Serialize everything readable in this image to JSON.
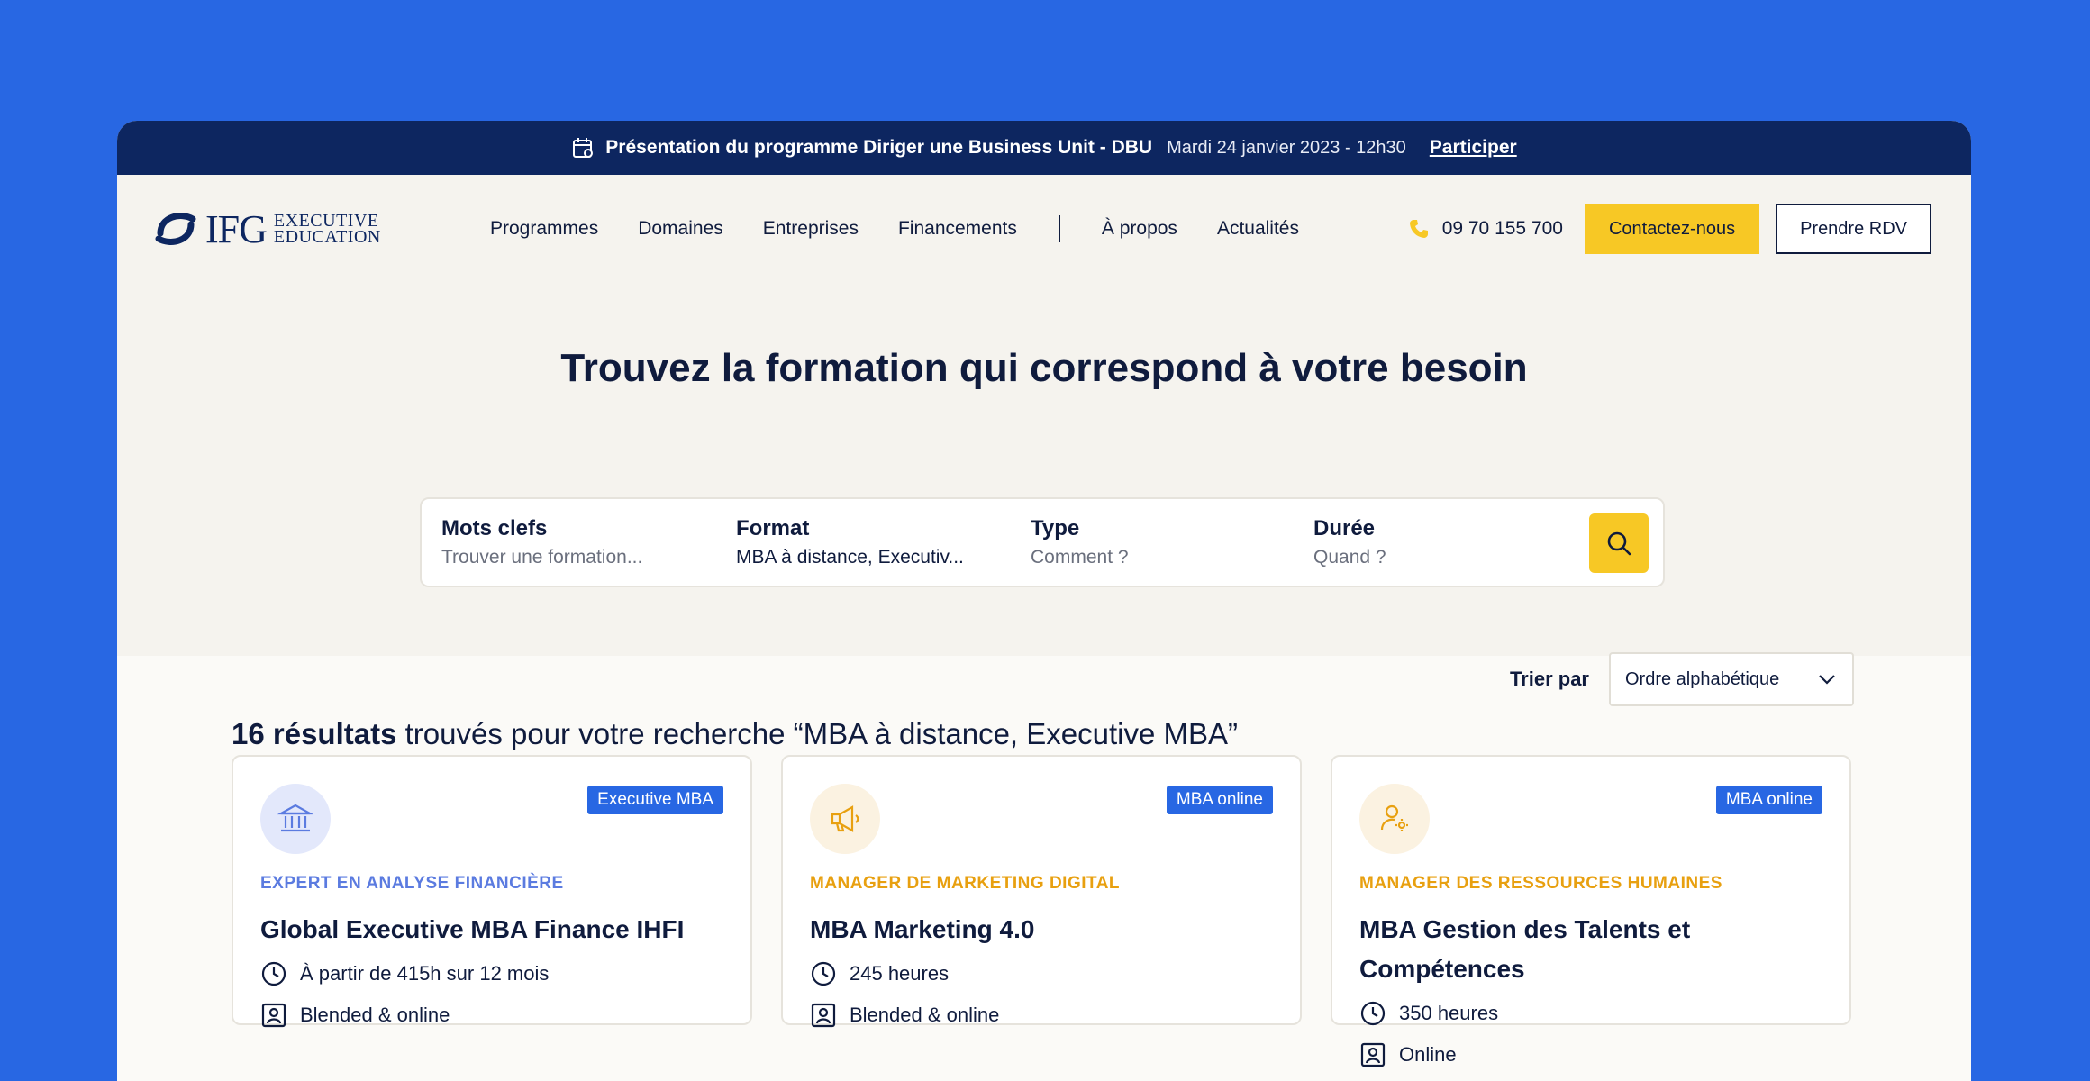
{
  "announcement": {
    "title": "Présentation du programme Diriger une Business Unit - DBU",
    "date": "Mardi 24 janvier 2023 - 12h30",
    "cta": "Participer"
  },
  "logo": {
    "brand": "IFG",
    "line1": "EXECUTIVE",
    "line2": "EDUCATION"
  },
  "nav": {
    "items": [
      "Programmes",
      "Domaines",
      "Entreprises",
      "Financements"
    ],
    "items_right": [
      "À propos",
      "Actualités"
    ],
    "phone": "09 70 155 700",
    "contact_button": "Contactez-nous",
    "rdv_button": "Prendre RDV"
  },
  "hero": {
    "title": "Trouvez la formation qui correspond à votre besoin"
  },
  "search": {
    "fields": [
      {
        "label": "Mots clefs",
        "value": "Trouver une formation...",
        "is_placeholder": true
      },
      {
        "label": "Format",
        "value": "MBA à distance, Executiv...",
        "is_placeholder": false
      },
      {
        "label": "Type",
        "value": "Comment ?",
        "is_placeholder": true
      },
      {
        "label": "Durée",
        "value": "Quand ?",
        "is_placeholder": true
      }
    ],
    "button_icon": "search-icon"
  },
  "results": {
    "count": "16 résultats",
    "text": "trouvés pour votre recherche “MBA à distance, Executive MBA”",
    "sort_label": "Trier par",
    "sort_value": "Ordre alphabétique"
  },
  "cards": [
    {
      "badge": "Executive MBA",
      "category": "EXPERT EN ANALYSE FINANCIÈRE",
      "category_color": "#5b7be0",
      "icon": "bank-icon",
      "icon_bg": "#e3e8fb",
      "title_lines": [
        "Global Executive MBA  Finance IHFI"
      ],
      "duration": "À partir de 415h sur 12 mois",
      "mode": "Blended & online"
    },
    {
      "badge": "MBA online",
      "category": "MANAGER DE MARKETING DIGITAL",
      "category_color": "#e8a010",
      "icon": "megaphone-icon",
      "icon_bg": "#fbf2e1",
      "title_lines": [
        "MBA Marketing 4.0"
      ],
      "duration": "245 heures",
      "mode": "Blended & online"
    },
    {
      "badge": "MBA online",
      "category": "MANAGER DES RESSOURCES HUMAINES",
      "category_color": "#e8a010",
      "icon": "user-gear-icon",
      "icon_bg": "#fbf2e1",
      "title_lines": [
        "MBA Gestion des Talents et",
        "Compétences"
      ],
      "duration": "350 heures",
      "mode": "Online"
    }
  ],
  "colors": {
    "background": "#2867e3",
    "announcement_bar": "#0d2660",
    "accent_yellow": "#f7c825",
    "badge_blue": "#2867e3"
  }
}
